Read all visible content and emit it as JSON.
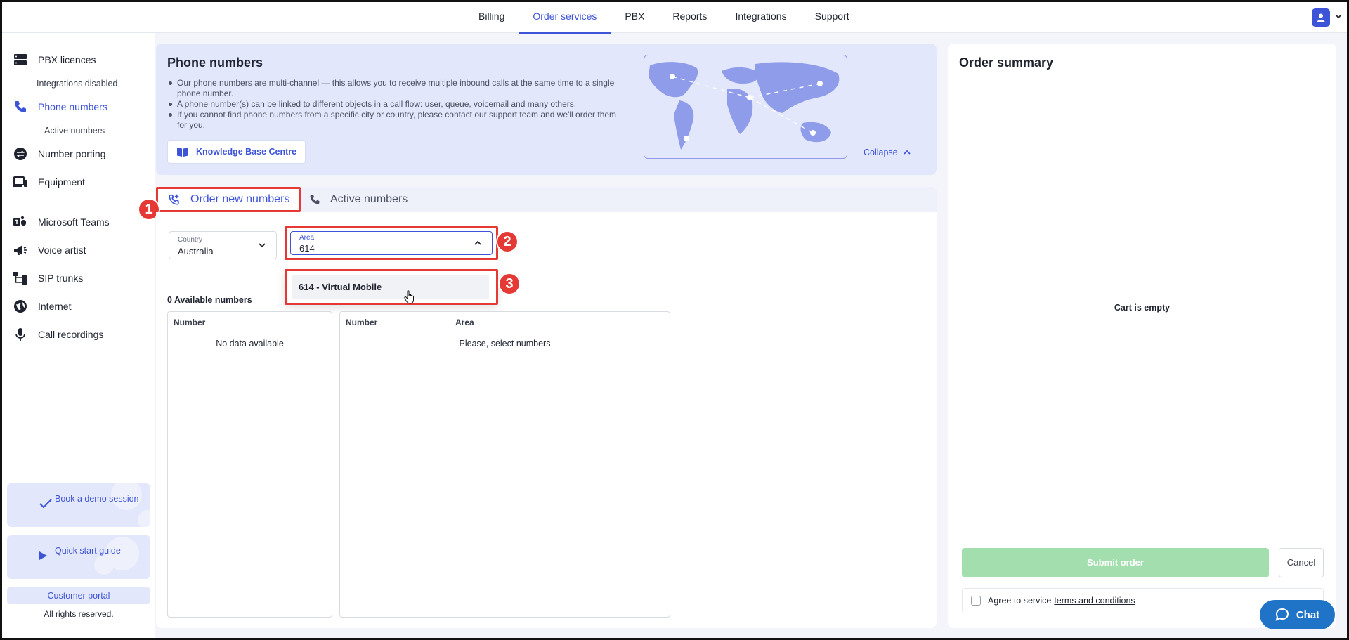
{
  "topnav": {
    "tabs": [
      {
        "label": "Billing"
      },
      {
        "label": "Order services"
      },
      {
        "label": "PBX"
      },
      {
        "label": "Reports"
      },
      {
        "label": "Integrations"
      },
      {
        "label": "Support"
      }
    ],
    "active_tab": "Order services"
  },
  "sidebar": {
    "items": [
      {
        "label": "PBX licences",
        "icon": "server-icon"
      },
      {
        "label": "Phone numbers",
        "icon": "phone-icon"
      },
      {
        "label": "Number porting",
        "icon": "transfer-icon"
      },
      {
        "label": "Equipment",
        "icon": "devices-icon"
      },
      {
        "label": "Microsoft Teams",
        "icon": "teams-icon"
      },
      {
        "label": "Voice artist",
        "icon": "megaphone-icon"
      },
      {
        "label": "SIP trunks",
        "icon": "network-icon"
      },
      {
        "label": "Internet",
        "icon": "globe-icon"
      },
      {
        "label": "Call recordings",
        "icon": "microphone-icon"
      }
    ],
    "sub": {
      "integrations_disabled": "Integrations disabled",
      "active_numbers": "Active numbers"
    },
    "promo_demo": "Book a demo session",
    "promo_guide": "Quick start guide",
    "customer_portal": "Customer portal",
    "rights": "All rights reserved."
  },
  "info": {
    "title": "Phone numbers",
    "bullets": [
      "Our phone numbers are multi-channel — this allows you to receive multiple inbound calls at the same time to a single phone number.",
      "A phone number(s) can be linked to different objects in a call flow: user, queue, voicemail and many others.",
      "If you cannot find phone numbers from a specific city or country, please contact our support team and we'll order them for you."
    ],
    "kb_button": "Knowledge Base Centre",
    "collapse": "Collapse"
  },
  "tabs": {
    "order_new": "Order new numbers",
    "active": "Active numbers"
  },
  "form": {
    "country_label": "Country",
    "country_value": "Australia",
    "area_label": "Area",
    "area_value": "614",
    "dropdown_options": [
      "614 - Virtual Mobile"
    ]
  },
  "annotations": [
    "1",
    "2",
    "3"
  ],
  "available": "0 Available numbers",
  "left_table": {
    "header": "Number",
    "empty": "No data available"
  },
  "right_table": {
    "headers": [
      "Number",
      "Area"
    ],
    "empty": "Please, select numbers"
  },
  "summary": {
    "title": "Order summary",
    "cart": "Cart is empty",
    "submit": "Submit order",
    "cancel": "Cancel",
    "agree_prefix": "Agree to service",
    "agree_link": "terms and conditions"
  },
  "chat": "Chat",
  "colors": {
    "accent": "#3d53d8",
    "annotation": "#e53935",
    "submit_disabled": "#a3dfae",
    "chat": "#1f74c8"
  }
}
